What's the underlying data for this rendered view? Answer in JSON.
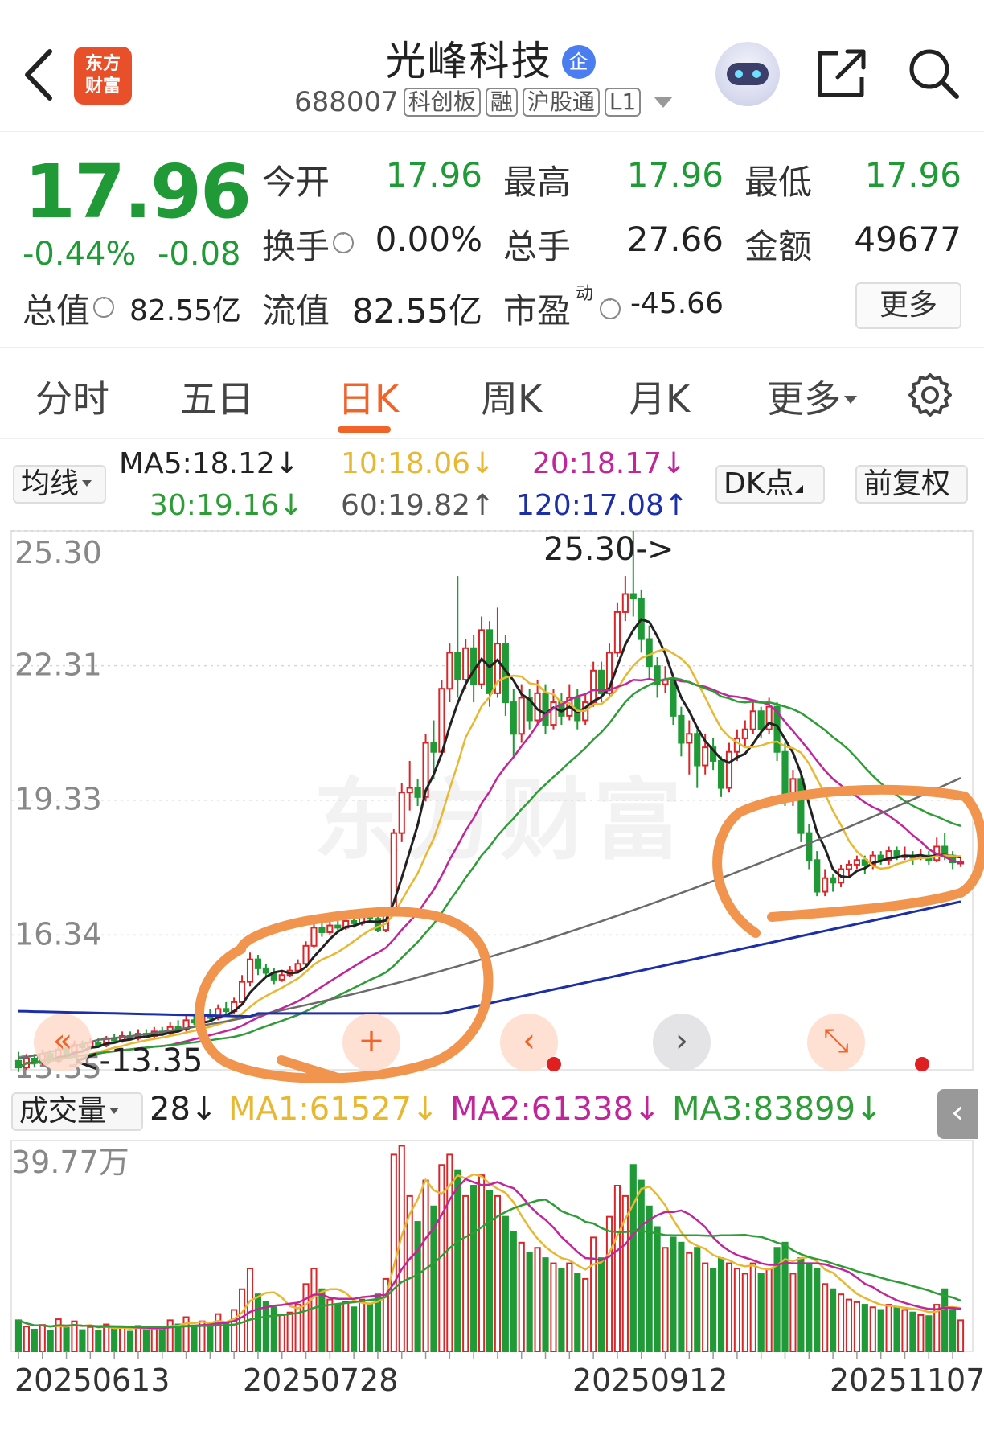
{
  "app": {
    "logo_line1": "东方",
    "logo_line2": "财富"
  },
  "header": {
    "stock_name": "光峰科技",
    "qi_badge": "企",
    "code": "688007",
    "tags": [
      "科创板",
      "融",
      "沪股通",
      "L1"
    ]
  },
  "quote": {
    "price": "17.96",
    "change_pct": "-0.44%",
    "change": "-0.08",
    "rows": [
      {
        "label": "今开",
        "value": "17.96"
      },
      {
        "label": "最高",
        "value": "17.96"
      },
      {
        "label": "最低",
        "value": "17.96"
      },
      {
        "label": "换手",
        "value": "0.00%"
      },
      {
        "label": "总手",
        "value": "27.66"
      },
      {
        "label": "金额",
        "value": "49677"
      },
      {
        "label": "总值",
        "value": "82.55亿"
      },
      {
        "label": "流值",
        "value": "82.55亿"
      },
      {
        "label": "市盈",
        "value": "-45.66"
      }
    ],
    "pe_sup": "动",
    "more_label": "更多"
  },
  "tabs": [
    {
      "label": "分时"
    },
    {
      "label": "五日"
    },
    {
      "label": "日K"
    },
    {
      "label": "周K"
    },
    {
      "label": "月K"
    },
    {
      "label": "更多"
    }
  ],
  "ma_legend": {
    "selector": "均线",
    "ma5": "MA5:18.12↓",
    "ma10": "10:18.06↓",
    "ma20": "20:18.17↓",
    "ma30": "30:19.16↓",
    "ma60": "60:19.82↑",
    "ma120": "120:17.08↑",
    "dk_label": "DK点",
    "adjust_label": "前复权"
  },
  "colors": {
    "up": "#d8272b",
    "down": "#1f9a36",
    "ma5": "#222222",
    "ma10": "#e8b832",
    "ma20": "#c0269a",
    "ma30": "#2e9d37",
    "ma60": "#6b6b6b",
    "ma120": "#1d2fa8",
    "annotation": "#f0944e"
  },
  "price_axis": {
    "labels": [
      "25.30",
      "22.31",
      "19.33",
      "16.34"
    ],
    "bottom_label": "13.35",
    "high_marker": "25.30->",
    "low_marker": "<-13.35"
  },
  "volume": {
    "selector": "成交量",
    "period": "28↓",
    "ma1": "MA1:61527↓",
    "ma2": "MA2:61338↓",
    "ma3": "MA3:83899↓",
    "max_label": "39.77万"
  },
  "dates": [
    "20250613",
    "20250728",
    "20250912",
    "20251107"
  ],
  "chart_data": {
    "type": "candlestick",
    "ylim": [
      13.35,
      25.3
    ],
    "volume_max": 397700,
    "candles": [
      [
        13.55,
        13.4,
        13.75,
        13.3,
        60000
      ],
      [
        13.4,
        13.6,
        13.7,
        13.35,
        48000
      ],
      [
        13.6,
        13.5,
        13.7,
        13.4,
        42000
      ],
      [
        13.5,
        13.7,
        13.8,
        13.45,
        51000
      ],
      [
        13.7,
        13.55,
        13.8,
        13.5,
        39000
      ],
      [
        13.55,
        13.8,
        13.9,
        13.5,
        62000
      ],
      [
        13.8,
        13.7,
        13.95,
        13.65,
        45000
      ],
      [
        13.7,
        13.9,
        14.0,
        13.65,
        58000
      ],
      [
        13.9,
        13.85,
        14.0,
        13.8,
        41000
      ],
      [
        13.85,
        13.95,
        14.05,
        13.8,
        47000
      ],
      [
        13.95,
        13.9,
        14.05,
        13.85,
        40000
      ],
      [
        13.9,
        14.05,
        14.1,
        13.85,
        52000
      ],
      [
        14.05,
        14.0,
        14.15,
        13.95,
        44000
      ],
      [
        14.0,
        14.1,
        14.2,
        13.95,
        46000
      ],
      [
        14.1,
        14.05,
        14.2,
        14.0,
        38000
      ],
      [
        14.05,
        14.15,
        14.25,
        14.0,
        49000
      ],
      [
        14.15,
        14.1,
        14.25,
        14.05,
        42000
      ],
      [
        14.1,
        14.2,
        14.3,
        14.05,
        47000
      ],
      [
        14.2,
        14.15,
        14.3,
        14.1,
        45000
      ],
      [
        14.15,
        14.3,
        14.4,
        14.1,
        60000
      ],
      [
        14.3,
        14.25,
        14.45,
        14.2,
        52000
      ],
      [
        14.25,
        14.45,
        14.55,
        14.2,
        66000
      ],
      [
        14.45,
        14.4,
        14.6,
        14.35,
        50000
      ],
      [
        14.4,
        14.55,
        14.65,
        14.35,
        58000
      ],
      [
        14.55,
        14.5,
        14.7,
        14.45,
        48000
      ],
      [
        14.5,
        14.7,
        14.8,
        14.45,
        72000
      ],
      [
        14.7,
        14.65,
        14.85,
        14.6,
        55000
      ],
      [
        14.65,
        14.85,
        14.95,
        14.6,
        80000
      ],
      [
        14.85,
        15.3,
        15.45,
        14.8,
        120000
      ],
      [
        15.3,
        15.8,
        15.95,
        15.2,
        160000
      ],
      [
        15.8,
        15.6,
        15.9,
        15.45,
        110000
      ],
      [
        15.6,
        15.5,
        15.7,
        15.4,
        95000
      ],
      [
        15.5,
        15.35,
        15.6,
        15.25,
        85000
      ],
      [
        15.35,
        15.45,
        15.55,
        15.3,
        70000
      ],
      [
        15.45,
        15.55,
        15.65,
        15.4,
        75000
      ],
      [
        15.55,
        15.7,
        15.8,
        15.5,
        90000
      ],
      [
        15.7,
        16.1,
        16.2,
        15.65,
        130000
      ],
      [
        16.1,
        16.5,
        16.65,
        16.05,
        160000
      ],
      [
        16.5,
        16.4,
        16.8,
        16.3,
        120000
      ],
      [
        16.4,
        16.55,
        16.7,
        16.35,
        100000
      ],
      [
        16.55,
        16.5,
        16.7,
        16.4,
        90000
      ],
      [
        16.5,
        16.65,
        16.75,
        16.45,
        95000
      ],
      [
        16.65,
        16.6,
        16.8,
        16.5,
        85000
      ],
      [
        16.6,
        16.75,
        16.85,
        16.55,
        100000
      ],
      [
        16.75,
        16.7,
        16.85,
        16.6,
        90000
      ],
      [
        16.7,
        16.45,
        16.8,
        16.4,
        110000
      ],
      [
        16.45,
        16.8,
        16.9,
        16.4,
        140000
      ],
      [
        16.8,
        18.6,
        18.7,
        16.75,
        380000
      ],
      [
        18.6,
        19.5,
        19.7,
        18.4,
        397000
      ],
      [
        19.5,
        19.6,
        20.2,
        19.1,
        300000
      ],
      [
        19.6,
        19.4,
        19.8,
        19.2,
        250000
      ],
      [
        19.4,
        20.6,
        20.8,
        19.3,
        330000
      ],
      [
        20.6,
        20.4,
        21.1,
        19.8,
        280000
      ],
      [
        20.4,
        21.8,
        22.0,
        20.3,
        360000
      ],
      [
        21.8,
        22.6,
        22.8,
        21.5,
        380000
      ],
      [
        22.6,
        22.0,
        24.3,
        21.6,
        350000
      ],
      [
        22.0,
        22.7,
        22.9,
        21.8,
        300000
      ],
      [
        22.7,
        21.9,
        23.0,
        21.5,
        320000
      ],
      [
        21.9,
        23.1,
        23.4,
        21.8,
        340000
      ],
      [
        23.1,
        21.7,
        23.3,
        21.4,
        310000
      ],
      [
        21.7,
        22.8,
        23.6,
        21.6,
        300000
      ],
      [
        22.8,
        21.5,
        23.0,
        21.2,
        260000
      ],
      [
        21.5,
        20.8,
        21.8,
        20.3,
        230000
      ],
      [
        20.8,
        21.6,
        21.9,
        20.6,
        210000
      ],
      [
        21.6,
        21.1,
        21.8,
        20.9,
        190000
      ],
      [
        21.1,
        21.7,
        22.0,
        21.0,
        200000
      ],
      [
        21.7,
        21.0,
        21.9,
        20.8,
        180000
      ],
      [
        21.0,
        21.5,
        21.8,
        20.9,
        170000
      ],
      [
        21.5,
        21.2,
        21.7,
        21.0,
        160000
      ],
      [
        21.2,
        21.6,
        21.9,
        21.1,
        170000
      ],
      [
        21.6,
        21.1,
        21.8,
        20.9,
        150000
      ],
      [
        21.1,
        21.5,
        21.7,
        21.0,
        140000
      ],
      [
        21.5,
        22.2,
        22.4,
        21.4,
        220000
      ],
      [
        22.2,
        21.7,
        22.4,
        21.5,
        180000
      ],
      [
        21.7,
        22.6,
        22.8,
        21.6,
        260000
      ],
      [
        22.6,
        23.5,
        23.7,
        22.5,
        320000
      ],
      [
        23.5,
        23.9,
        24.3,
        23.3,
        300000
      ],
      [
        23.9,
        23.8,
        25.3,
        23.4,
        360000
      ],
      [
        23.8,
        22.9,
        24.0,
        22.6,
        330000
      ],
      [
        22.9,
        22.3,
        23.2,
        22.0,
        280000
      ],
      [
        22.3,
        21.9,
        22.5,
        21.6,
        240000
      ],
      [
        21.9,
        22.0,
        22.3,
        21.7,
        200000
      ],
      [
        22.0,
        21.2,
        22.1,
        21.0,
        220000
      ],
      [
        21.2,
        20.6,
        21.4,
        20.3,
        210000
      ],
      [
        20.6,
        20.8,
        21.1,
        19.9,
        190000
      ],
      [
        20.8,
        20.1,
        20.9,
        19.6,
        200000
      ],
      [
        20.1,
        20.5,
        20.8,
        19.9,
        170000
      ],
      [
        20.5,
        20.2,
        20.7,
        20.0,
        160000
      ],
      [
        20.2,
        19.6,
        20.3,
        19.4,
        180000
      ],
      [
        19.6,
        20.4,
        20.6,
        19.5,
        170000
      ],
      [
        20.4,
        20.7,
        20.9,
        20.2,
        160000
      ],
      [
        20.7,
        20.9,
        21.1,
        20.5,
        150000
      ],
      [
        20.9,
        21.3,
        21.5,
        20.8,
        170000
      ],
      [
        21.3,
        20.9,
        21.4,
        20.7,
        150000
      ],
      [
        20.9,
        21.4,
        21.6,
        20.8,
        160000
      ],
      [
        21.4,
        20.4,
        21.5,
        20.2,
        200000
      ],
      [
        20.4,
        19.4,
        20.6,
        19.2,
        210000
      ],
      [
        19.4,
        19.8,
        20.0,
        19.2,
        150000
      ],
      [
        19.8,
        18.6,
        19.9,
        18.4,
        180000
      ],
      [
        18.6,
        18.0,
        18.8,
        17.8,
        170000
      ],
      [
        18.0,
        17.3,
        18.2,
        17.2,
        160000
      ],
      [
        17.3,
        17.6,
        17.8,
        17.2,
        130000
      ],
      [
        17.6,
        17.5,
        17.7,
        17.3,
        120000
      ],
      [
        17.5,
        17.8,
        17.9,
        17.4,
        110000
      ],
      [
        17.8,
        17.9,
        18.0,
        17.6,
        100000
      ],
      [
        17.9,
        18.0,
        18.1,
        17.8,
        95000
      ],
      [
        18.0,
        17.9,
        18.1,
        17.7,
        90000
      ],
      [
        17.9,
        18.1,
        18.2,
        17.8,
        85000
      ],
      [
        18.1,
        18.0,
        18.2,
        17.9,
        80000
      ],
      [
        18.0,
        18.2,
        18.3,
        17.9,
        90000
      ],
      [
        18.2,
        18.1,
        18.3,
        18.0,
        85000
      ],
      [
        18.1,
        18.1,
        18.3,
        18.0,
        80000
      ],
      [
        18.1,
        18.05,
        18.2,
        17.9,
        75000
      ],
      [
        18.05,
        18.1,
        18.25,
        18.0,
        70000
      ],
      [
        18.1,
        18.0,
        18.2,
        17.9,
        68000
      ],
      [
        18.0,
        18.3,
        18.5,
        17.95,
        90000
      ],
      [
        18.3,
        18.1,
        18.6,
        18.0,
        120000
      ],
      [
        18.1,
        17.95,
        18.2,
        17.8,
        80000
      ],
      [
        17.95,
        17.96,
        18.05,
        17.85,
        60000
      ]
    ],
    "ma60_start": 13.9,
    "ma120_start": 14.6,
    "ma120_end": 17.08,
    "ma60_end": 19.82
  }
}
